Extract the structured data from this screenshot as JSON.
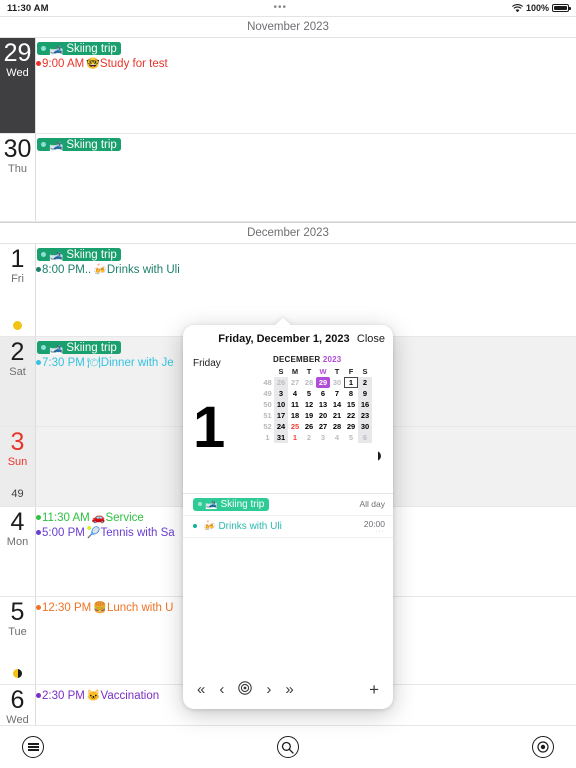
{
  "statusbar": {
    "time": "11:30 AM",
    "dots": "•••",
    "battery": "100%"
  },
  "months": {
    "first": "November 2023",
    "second": "December 2023"
  },
  "days": [
    {
      "num": "29",
      "wd": "Wed",
      "today": true,
      "weekend": false,
      "weeknum": "",
      "moon": "",
      "events": [
        {
          "kind": "badge",
          "emoji": "🎿",
          "title": "Skiing trip",
          "color": "#1a9f6e"
        },
        {
          "kind": "timed",
          "time": "9:00 AM",
          "emoji": "🤓",
          "title": "Study for test",
          "color": "#e8352b"
        }
      ]
    },
    {
      "num": "30",
      "wd": "Thu",
      "today": false,
      "weekend": false,
      "weeknum": "",
      "moon": "",
      "events": [
        {
          "kind": "badge",
          "emoji": "🎿",
          "title": "Skiing trip",
          "color": "#1a9f6e"
        }
      ]
    },
    {
      "num": "1",
      "wd": "Fri",
      "today": false,
      "weekend": false,
      "weeknum": "",
      "moon": "",
      "events": [
        {
          "kind": "badge",
          "emoji": "🎿",
          "title": "Skiing trip",
          "color": "#1a9f6e"
        },
        {
          "kind": "timed",
          "time": "8:00 PM..",
          "emoji": "🍻",
          "title": "Drinks with Uli",
          "color": "#1b7f6b"
        }
      ]
    },
    {
      "num": "2",
      "wd": "Sat",
      "today": false,
      "weekend": true,
      "weeknum": "",
      "moon": "full",
      "events": [
        {
          "kind": "badge",
          "emoji": "🎿",
          "title": "Skiing trip",
          "color": "#1a9f6e"
        },
        {
          "kind": "timed",
          "time": "7:30 PM",
          "emoji": "🍽",
          "title": "Dinner with Je",
          "color": "#35c2e0"
        }
      ]
    },
    {
      "num": "3",
      "wd": "Sun",
      "today": false,
      "weekend": true,
      "sunday": true,
      "weeknum": "",
      "moon": "",
      "events": []
    },
    {
      "num": "4",
      "wd": "Mon",
      "today": false,
      "weekend": false,
      "weeknum": "49",
      "moon": "",
      "events": [
        {
          "kind": "timed",
          "time": "11:30 AM",
          "emoji": "🚗",
          "title": "Service",
          "color": "#2ec13f"
        },
        {
          "kind": "timed",
          "time": "5:00 PM",
          "emoji": "🎾",
          "title": "Tennis with Sa",
          "color": "#6a3fd0"
        }
      ]
    },
    {
      "num": "5",
      "wd": "Tue",
      "today": false,
      "weekend": false,
      "weeknum": "",
      "moon": "",
      "events": [
        {
          "kind": "timed",
          "time": "12:30 PM",
          "emoji": "🍔",
          "title": "Lunch with U",
          "color": "#ef7324"
        }
      ]
    },
    {
      "num": "6",
      "wd": "Wed",
      "today": false,
      "weekend": false,
      "weeknum": "",
      "moon": "half",
      "events": [
        {
          "kind": "timed",
          "time": "2:30 PM",
          "emoji": "🐱",
          "title": "Vaccination",
          "color": "#7b2fc4"
        }
      ]
    }
  ],
  "popup": {
    "title": "Friday, December 1, 2023",
    "close_label": "Close",
    "weekday": "Friday",
    "big_day": "1",
    "mini": {
      "month_label": "DECEMBER",
      "year_label": "2023",
      "weekday_headers": [
        "S",
        "M",
        "T",
        "W",
        "T",
        "F",
        "S"
      ],
      "weeks": [
        {
          "wk": "48",
          "cur": true,
          "days": [
            {
              "d": "26",
              "dim": true,
              "sun": true
            },
            {
              "d": "27",
              "dim": true
            },
            {
              "d": "28",
              "dim": true
            },
            {
              "d": "29",
              "dim": true,
              "sel": true
            },
            {
              "d": "30",
              "dim": true
            },
            {
              "d": "1",
              "box": true
            },
            {
              "d": "2",
              "sat": true
            }
          ]
        },
        {
          "wk": "49",
          "days": [
            {
              "d": "3",
              "sun": true
            },
            {
              "d": "4"
            },
            {
              "d": "5"
            },
            {
              "d": "6"
            },
            {
              "d": "7"
            },
            {
              "d": "8"
            },
            {
              "d": "9",
              "sat": true
            }
          ]
        },
        {
          "wk": "50",
          "days": [
            {
              "d": "10",
              "sun": true
            },
            {
              "d": "11"
            },
            {
              "d": "12"
            },
            {
              "d": "13"
            },
            {
              "d": "14"
            },
            {
              "d": "15"
            },
            {
              "d": "16",
              "sat": true
            }
          ]
        },
        {
          "wk": "51",
          "days": [
            {
              "d": "17",
              "sun": true
            },
            {
              "d": "18"
            },
            {
              "d": "19"
            },
            {
              "d": "20"
            },
            {
              "d": "21"
            },
            {
              "d": "22"
            },
            {
              "d": "23",
              "sat": true
            }
          ]
        },
        {
          "wk": "52",
          "days": [
            {
              "d": "24",
              "sun": true
            },
            {
              "d": "25",
              "red": true
            },
            {
              "d": "26"
            },
            {
              "d": "27"
            },
            {
              "d": "28"
            },
            {
              "d": "29"
            },
            {
              "d": "30",
              "sat": true
            }
          ]
        },
        {
          "wk": "1",
          "days": [
            {
              "d": "31",
              "sun": true
            },
            {
              "d": "1",
              "red": true
            },
            {
              "d": "2",
              "dim": true
            },
            {
              "d": "3",
              "dim": true
            },
            {
              "d": "4",
              "dim": true
            },
            {
              "d": "5",
              "dim": true
            },
            {
              "d": "6",
              "dim": true,
              "sat": true
            }
          ]
        }
      ],
      "moon_phase": "waning"
    },
    "events": [
      {
        "kind": "badge",
        "emoji": "🎿",
        "title": "Skiing trip",
        "right": "All day",
        "sub": ""
      },
      {
        "kind": "timed",
        "emoji": "🍻",
        "title": "Drinks with Uli",
        "right": "20:00",
        "sub": "···"
      }
    ],
    "footer": {
      "first_label": "«",
      "prev_label": "‹",
      "today_label": "today-target",
      "next_label": "›",
      "last_label": "»",
      "add_label": "+"
    }
  },
  "toolbar": {
    "menu_label": "menu",
    "search_label": "search",
    "today_label": "today"
  }
}
